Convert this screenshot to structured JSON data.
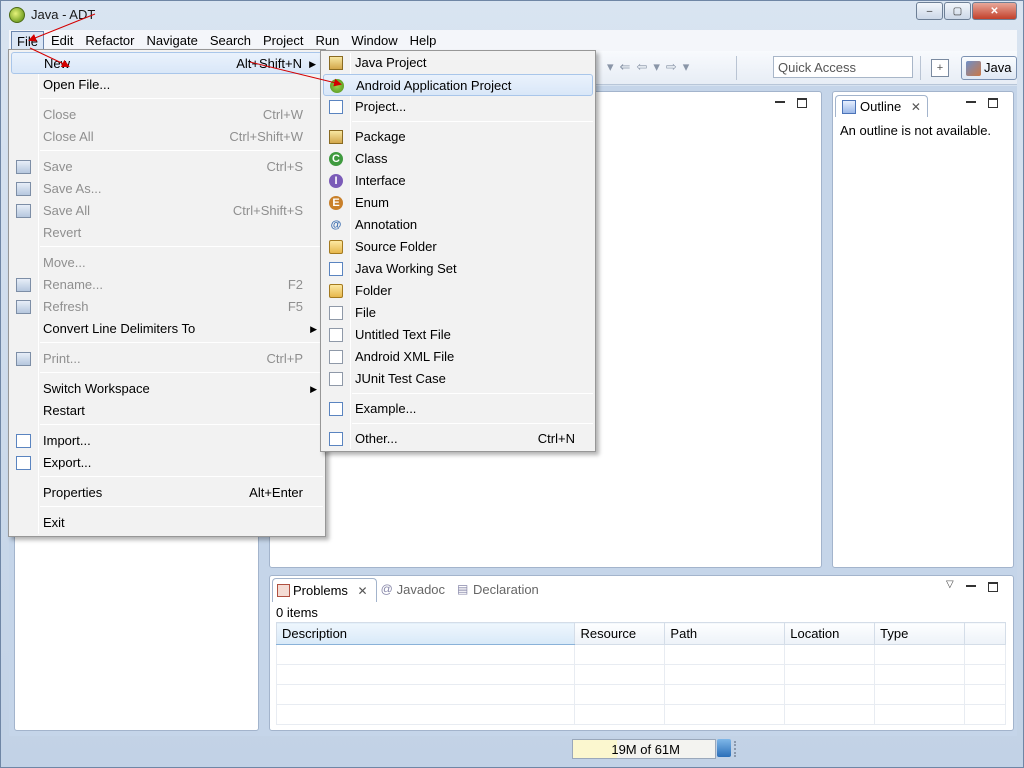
{
  "window": {
    "title": "Java - ADT",
    "buttons": [
      "–",
      "▢",
      "✕"
    ]
  },
  "menubar": {
    "items": [
      {
        "label": "File",
        "active": true
      },
      {
        "label": "Edit"
      },
      {
        "label": "Refactor"
      },
      {
        "label": "Navigate"
      },
      {
        "label": "Search"
      },
      {
        "label": "Project"
      },
      {
        "label": "Run"
      },
      {
        "label": "Window"
      },
      {
        "label": "Help"
      }
    ]
  },
  "toolbar": {
    "quick_access_placeholder": "Quick Access",
    "perspective_label": "Java"
  },
  "file_menu": {
    "items": [
      {
        "label": "New",
        "accel": "Alt+Shift+N",
        "submenu": true,
        "highlighted": true
      },
      {
        "label": "Open File..."
      },
      {
        "label": "Close",
        "accel": "Ctrl+W",
        "disabled": true
      },
      {
        "label": "Close All",
        "accel": "Ctrl+Shift+W",
        "disabled": true
      },
      {
        "label": "Save",
        "accel": "Ctrl+S",
        "disabled": true
      },
      {
        "label": "Save As...",
        "disabled": true
      },
      {
        "label": "Save All",
        "accel": "Ctrl+Shift+S",
        "disabled": true
      },
      {
        "label": "Revert",
        "disabled": true
      },
      {
        "label": "Move...",
        "disabled": true
      },
      {
        "label": "Rename...",
        "accel": "F2",
        "disabled": true
      },
      {
        "label": "Refresh",
        "accel": "F5",
        "disabled": true
      },
      {
        "label": "Convert Line Delimiters To",
        "submenu": true
      },
      {
        "label": "Print...",
        "accel": "Ctrl+P",
        "disabled": true
      },
      {
        "label": "Switch Workspace",
        "submenu": true
      },
      {
        "label": "Restart"
      },
      {
        "label": "Import..."
      },
      {
        "label": "Export..."
      },
      {
        "label": "Properties",
        "accel": "Alt+Enter"
      },
      {
        "label": "Exit"
      }
    ]
  },
  "new_submenu": {
    "items": [
      {
        "label": "Java Project",
        "icon": "java-project-icon"
      },
      {
        "label": "Android Application Project",
        "icon": "android-project-icon",
        "highlighted": true
      },
      {
        "label": "Project...",
        "icon": "project-icon"
      },
      {
        "label": "Package",
        "icon": "package-icon"
      },
      {
        "label": "Class",
        "icon": "class-icon"
      },
      {
        "label": "Interface",
        "icon": "interface-icon"
      },
      {
        "label": "Enum",
        "icon": "enum-icon"
      },
      {
        "label": "Annotation",
        "icon": "annotation-icon"
      },
      {
        "label": "Source Folder",
        "icon": "source-folder-icon"
      },
      {
        "label": "Java Working Set",
        "icon": "working-set-icon"
      },
      {
        "label": "Folder",
        "icon": "folder-icon"
      },
      {
        "label": "File",
        "icon": "file-icon"
      },
      {
        "label": "Untitled Text File",
        "icon": "text-file-icon"
      },
      {
        "label": "Android XML File",
        "icon": "android-xml-icon"
      },
      {
        "label": "JUnit Test Case",
        "icon": "junit-icon"
      },
      {
        "label": "Example...",
        "icon": "example-icon"
      },
      {
        "label": "Other...",
        "accel": "Ctrl+N",
        "icon": "wizard-icon"
      }
    ]
  },
  "outline": {
    "tab_label": "Outline",
    "message": "An outline is not available."
  },
  "problems": {
    "tabs": [
      "Problems",
      "Javadoc",
      "Declaration"
    ],
    "items_count": "0 items",
    "columns": [
      "Description",
      "Resource",
      "Path",
      "Location",
      "Type"
    ]
  },
  "status": {
    "heap": "19M of 61M",
    "heap_used_fraction": 0.31
  },
  "colors": {
    "highlight": "#d9e7f8",
    "annotation_arrow": "#d40000"
  }
}
